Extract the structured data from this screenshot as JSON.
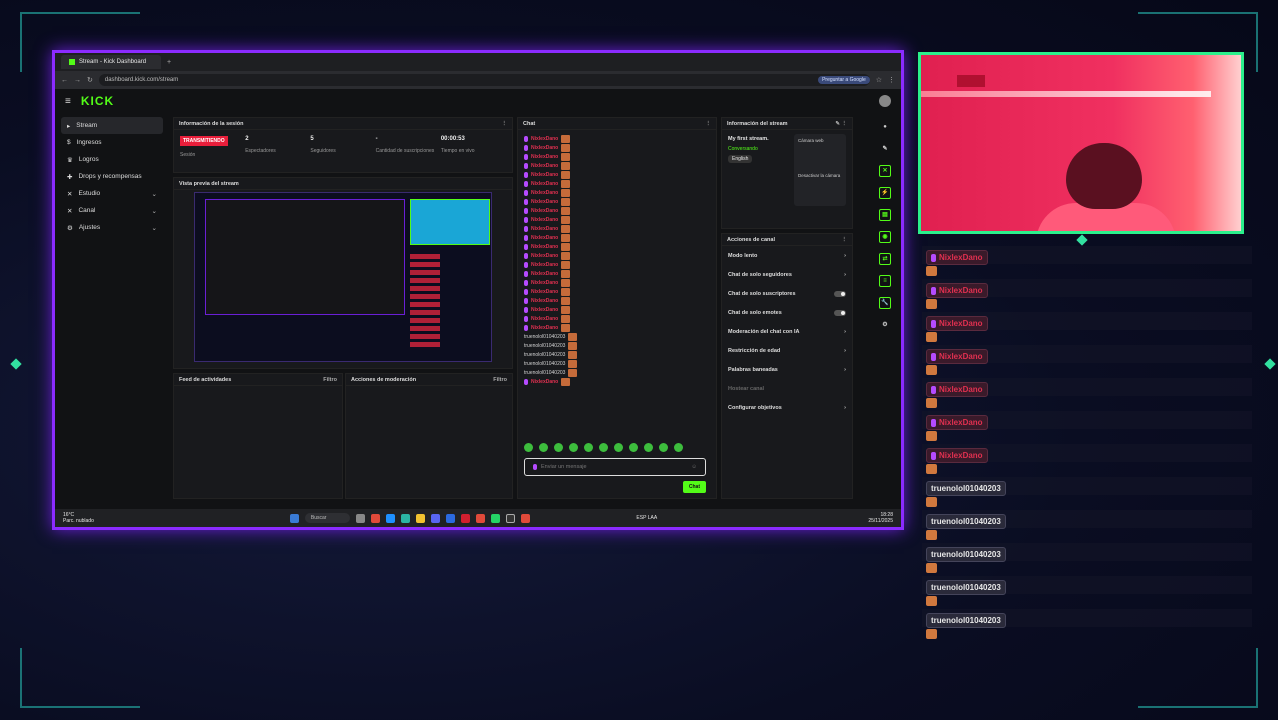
{
  "browser": {
    "tab_title": "Stream - Kick Dashboard",
    "url": "dashboard.kick.com/stream",
    "ai_pill": "Preguntar a Google"
  },
  "app": {
    "logo": "KICK",
    "sidebar": [
      {
        "label": "Stream",
        "icon": "stream-icon",
        "active": true
      },
      {
        "label": "Ingresos",
        "icon": "money-icon"
      },
      {
        "label": "Logros",
        "icon": "trophy-icon"
      },
      {
        "label": "Drops y recompensas",
        "icon": "gift-icon"
      },
      {
        "label": "Estudio",
        "icon": "studio-icon",
        "chevron": true
      },
      {
        "label": "Canal",
        "icon": "channel-icon",
        "chevron": true
      },
      {
        "label": "Ajustes",
        "icon": "gear-icon",
        "chevron": true
      }
    ],
    "session": {
      "title": "Información de la sesión",
      "stats": [
        {
          "value": "TRANSMITIENDO",
          "label": "Sesión"
        },
        {
          "value": "2",
          "label": "Espectadores"
        },
        {
          "value": "5",
          "label": "Seguidores"
        },
        {
          "value": "-",
          "label": "Cantidad de suscripciones"
        },
        {
          "value": "00:00:53",
          "label": "Tiempo en vivo"
        }
      ]
    },
    "preview": {
      "title": "Vista previa del stream"
    },
    "feed": {
      "title": "Feed de actividades",
      "filter": "Filtro"
    },
    "mod": {
      "title": "Acciones de moderación",
      "filter": "Filtro"
    },
    "chat": {
      "title": "Chat",
      "messages": [
        {
          "name": "NixlexDano"
        },
        {
          "name": "NixlexDano"
        },
        {
          "name": "NixlexDano"
        },
        {
          "name": "NixlexDano"
        },
        {
          "name": "NixlexDano"
        },
        {
          "name": "NixlexDano"
        },
        {
          "name": "NixlexDano"
        },
        {
          "name": "NixlexDano"
        },
        {
          "name": "NixlexDano"
        },
        {
          "name": "NixlexDano"
        },
        {
          "name": "NixlexDano"
        },
        {
          "name": "NixlexDano"
        },
        {
          "name": "NixlexDano"
        },
        {
          "name": "NixlexDano"
        },
        {
          "name": "NixlexDano"
        },
        {
          "name": "NixlexDano"
        },
        {
          "name": "NixlexDano"
        },
        {
          "name": "NixlexDano"
        },
        {
          "name": "NixlexDano"
        },
        {
          "name": "NixlexDano"
        },
        {
          "name": "NixlexDano"
        },
        {
          "name": "NixlexDano"
        },
        {
          "name": "truenolol01040203",
          "plain": true
        },
        {
          "name": "truenolol01040203",
          "plain": true
        },
        {
          "name": "truenolol01040203",
          "plain": true
        },
        {
          "name": "truenolol01040203",
          "plain": true
        },
        {
          "name": "truenolol01040203",
          "plain": true
        },
        {
          "name": "NixlexDano"
        }
      ],
      "input_placeholder": "Enviar un mensaje",
      "send_label": "Chat"
    },
    "info": {
      "title": "Información del stream",
      "stream_title": "My first stream.",
      "category": "Conversando",
      "language": "English",
      "card_label": "Cámara web",
      "card_caption": "Desactivar la cámara"
    },
    "actions": {
      "title": "Acciones de canal",
      "items": [
        {
          "label": "Modo lento",
          "ctrl": "chevron"
        },
        {
          "label": "Chat de solo seguidores",
          "ctrl": "chevron"
        },
        {
          "label": "Chat de solo suscriptores",
          "ctrl": "toggle"
        },
        {
          "label": "Chat de solo emotes",
          "ctrl": "toggle"
        },
        {
          "label": "Moderación del chat con IA",
          "ctrl": "chevron"
        },
        {
          "label": "Restricción de edad",
          "ctrl": "chevron"
        },
        {
          "label": "Palabras baneadas",
          "ctrl": "chevron"
        },
        {
          "label": "Hostear canal",
          "ctrl": "none",
          "disabled": true
        },
        {
          "label": "Configurar objetivos",
          "ctrl": "chevron"
        }
      ]
    }
  },
  "taskbar": {
    "weather_temp": "16°C",
    "weather_desc": "Parc. nublado",
    "search": "Buscar",
    "lang": "ESP LAA",
    "time": "18:28",
    "date": "25/11/2025"
  },
  "overlay_chat": [
    {
      "name": "NixlexDano"
    },
    {
      "name": "NixlexDano"
    },
    {
      "name": "NixlexDano"
    },
    {
      "name": "NixlexDano"
    },
    {
      "name": "NixlexDano"
    },
    {
      "name": "NixlexDano"
    },
    {
      "name": "NixlexDano"
    },
    {
      "name": "truenolol01040203",
      "plain": true
    },
    {
      "name": "truenolol01040203",
      "plain": true
    },
    {
      "name": "truenolol01040203",
      "plain": true
    },
    {
      "name": "truenolol01040203",
      "plain": true
    },
    {
      "name": "truenolol01040203",
      "plain": true
    }
  ],
  "colors": {
    "kick_green": "#53fc18",
    "frame_purple": "#8b2bff",
    "cam_border": "#2bf08c",
    "live_red": "#e91e3b"
  }
}
